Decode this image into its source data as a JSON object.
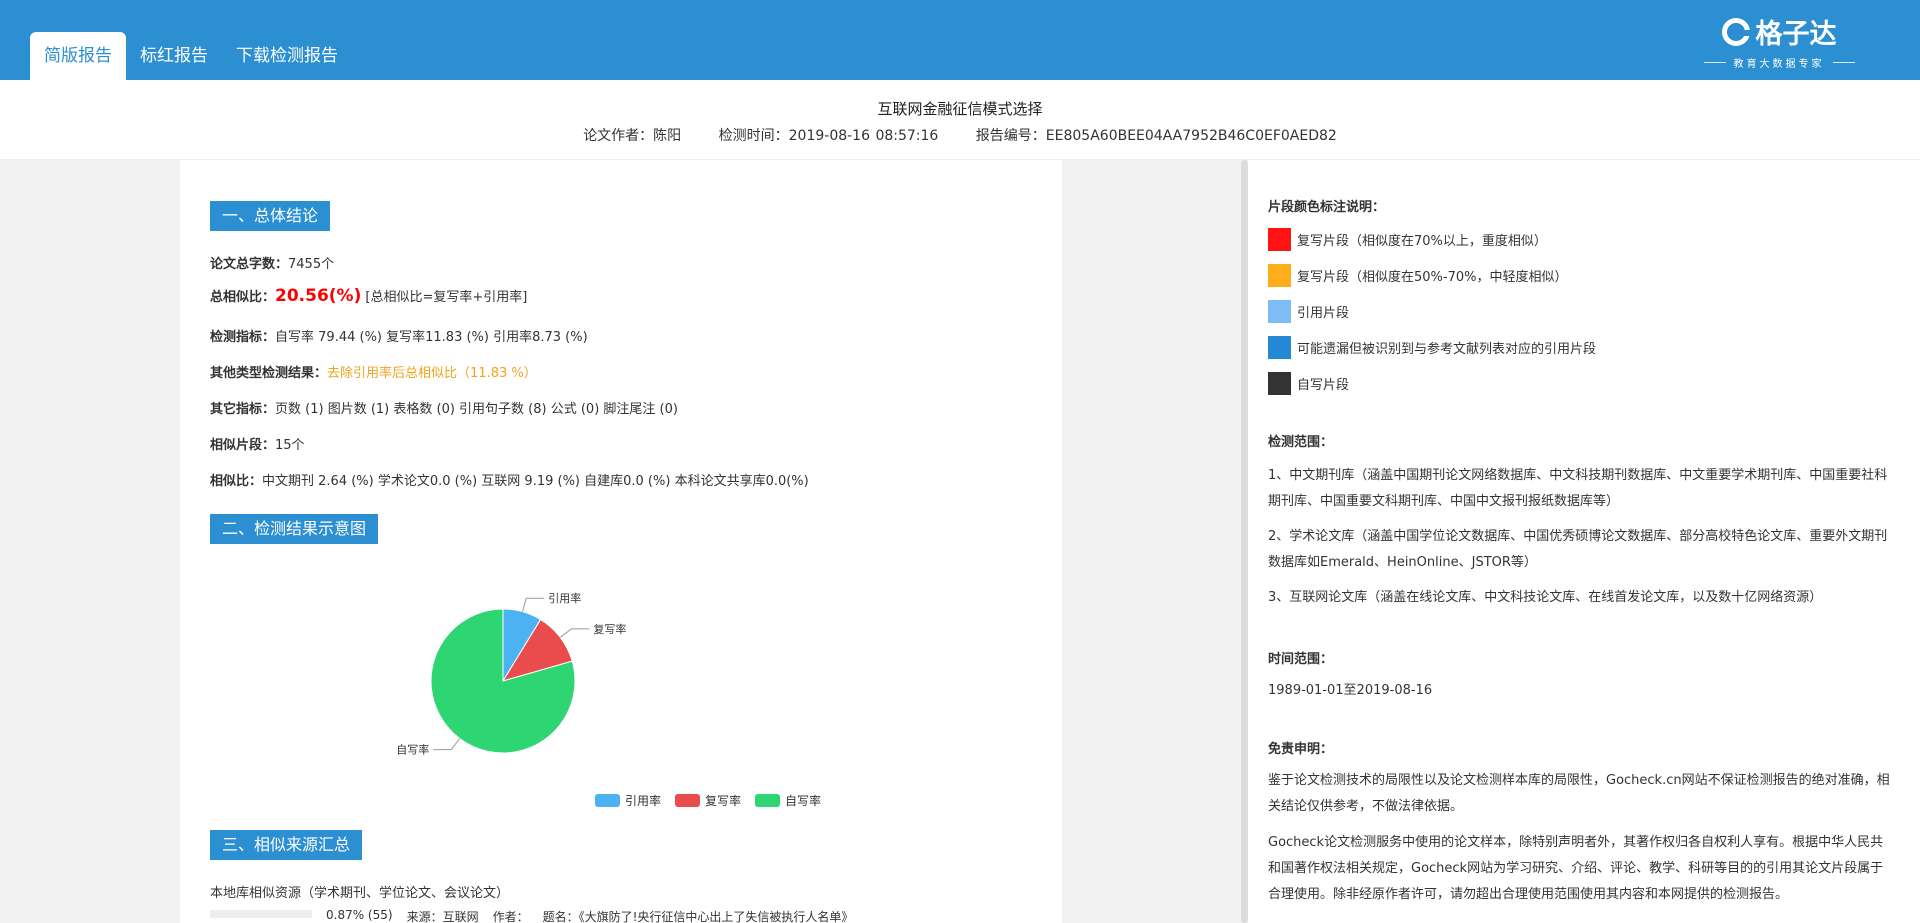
{
  "header": {
    "tabs": [
      {
        "label": "简版报告",
        "active": true
      },
      {
        "label": "标红报告",
        "active": false
      },
      {
        "label": "下载检测报告",
        "active": false
      }
    ],
    "logo": {
      "name": "格子达",
      "tagline": "教育大数据专家"
    }
  },
  "report": {
    "title": "互联网金融征信模式选择",
    "author": "论文作者：陈阳",
    "check_time": "检测时间：2019-08-16 08:57:16",
    "report_no": "报告编号：EE805A60BEE04AA7952B46C0EF0AED82"
  },
  "sections": {
    "s1_title": "一、总体结论",
    "s2_title": "二、检测结果示意图",
    "s3_title": "三、相似来源汇总"
  },
  "summary": {
    "total_chars_label": "论文总字数：",
    "total_chars_value": "7455个",
    "similarity_label": "总相似比：",
    "similarity_value": "20.56(%)",
    "similarity_note": "[总相似比=复写率+引用率]",
    "metrics_label": "检测指标：",
    "metrics_value": "自写率 79.44 (%) 复写率11.83 (%) 引用率8.73 (%)",
    "other_result_label": "其他类型检测结果：",
    "other_result_value": "去除引用率后总相似比（11.83 %）",
    "other_index_label": "其它指标：",
    "other_index_value": "页数 (1) 图片数 (1) 表格数 (0) 引用句子数 (8) 公式 (0) 脚注尾注 (0)",
    "fragments_label": "相似片段：",
    "fragments_value": "15个",
    "ratio_label": "相似比：",
    "ratio_value": "中文期刊 2.64 (%) 学术论文0.0 (%) 互联网 9.19 (%) 自建库0.0 (%) 本科论文共享库0.0(%)"
  },
  "chart_data": {
    "type": "pie",
    "slices": [
      {
        "name": "引用率",
        "value": 8.73,
        "color": "#4cb2f2"
      },
      {
        "name": "复写率",
        "value": 11.83,
        "color": "#e84c4c"
      },
      {
        "name": "自写率",
        "value": 79.44,
        "color": "#2ed573"
      }
    ],
    "legend_position": "bottom"
  },
  "sources": {
    "intro": "本地库相似资源（学术期刊、学位论文、会议论文）",
    "first_row": {
      "ratio": "0.87% (55)",
      "source": "来源：互联网",
      "author": "作者：",
      "title": "题名：《大旗防了!央行征信中心出上了失信被执行人名单》"
    }
  },
  "right": {
    "legend_title": "片段颜色标注说明：",
    "colors": [
      {
        "color": "#ff1414",
        "label": "复写片段（相似度在70%以上，重度相似）"
      },
      {
        "color": "#ffae1a",
        "label": "复写片段（相似度在50%-70%，中轻度相似）"
      },
      {
        "color": "#7dbcf5",
        "label": "引用片段"
      },
      {
        "color": "#2389d5",
        "label": "可能遗漏但被识别到与参考文献列表对应的引用片段"
      },
      {
        "color": "#333333",
        "label": "自写片段"
      }
    ],
    "range_title": "检测范围：",
    "range_items": [
      "1、中文期刊库（涵盖中国期刊论文网络数据库、中文科技期刊数据库、中文重要学术期刊库、中国重要社科期刊库、中国重要文科期刊库、中国中文报刊报纸数据库等）",
      "2、学术论文库（涵盖中国学位论文数据库、中国优秀硕博论文数据库、部分高校特色论文库、重要外文期刊数据库如Emerald、HeinOnline、JSTOR等）",
      "3、互联网论文库（涵盖在线论文库、中文科技论文库、在线首发论文库，以及数十亿网络资源）"
    ],
    "time_title": "时间范围：",
    "time_value": "1989-01-01至2019-08-16",
    "disclaimer_title": "免责申明：",
    "disclaimer_1": "鉴于论文检测技术的局限性以及论文检测样本库的局限性，Gocheck.cn网站不保证检测报告的绝对准确，相关结论仅供参考，不做法律依据。",
    "disclaimer_2": "Gocheck论文检测服务中使用的论文样本，除特别声明者外，其著作权归各自权利人享有。根据中华人民共和国著作权法相关规定，Gocheck网站为学习研究、介绍、评论、教学、科研等目的的引用其论文片段属于合理使用。除非经原作者许可，请勿超出合理使用范围使用其内容和本网提供的检测报告。"
  }
}
